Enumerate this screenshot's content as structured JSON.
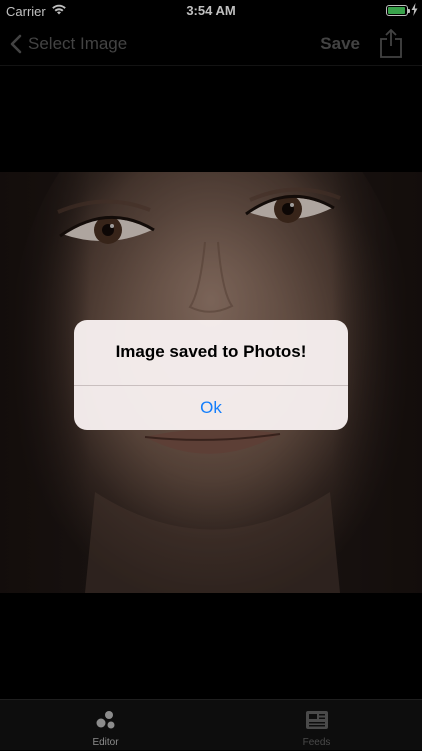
{
  "status_bar": {
    "carrier": "Carrier",
    "time": "3:54 AM",
    "battery_level": 0.95
  },
  "nav": {
    "back_label": "Select Image",
    "save_label": "Save",
    "share_icon": "share-icon"
  },
  "alert": {
    "title": "Image saved to Photos!",
    "button_label": "Ok"
  },
  "tabs": [
    {
      "label": "Editor",
      "icon": "bubbles-icon",
      "active": true
    },
    {
      "label": "Feeds",
      "icon": "newspaper-icon",
      "active": false
    }
  ],
  "colors": {
    "alert_button": "#147efb",
    "battery_fill": "#4cd964",
    "nav_disabled": "#5a5a5a"
  }
}
